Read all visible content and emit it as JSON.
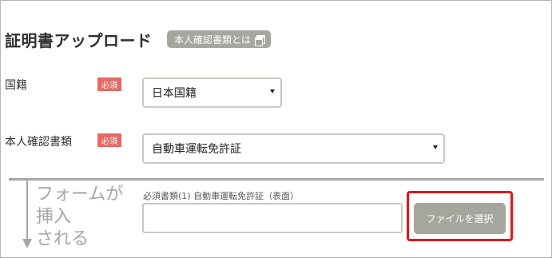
{
  "page": {
    "title": "証明書アップロード",
    "help_badge_label": "本人確認書類とは"
  },
  "form": {
    "nationality": {
      "label": "国籍",
      "required_label": "必須",
      "selected_value": "日本国籍"
    },
    "id_document": {
      "label": "本人確認書類",
      "required_label": "必須",
      "selected_value": "自動車運転免許証"
    }
  },
  "annotation": {
    "inserted_note": "フォームが\n挿入\nされる",
    "highlight_color": "#e0161c"
  },
  "upload": {
    "caption": "必須書類(1) 自動車運転免許証（表面）",
    "file_name_value": "",
    "select_button_label": "ファイルを選択"
  },
  "colors": {
    "required_badge": "#e56a62",
    "gray_button": "#a6a59e",
    "annotation_gray": "#a7a7a7"
  },
  "icons": {
    "help_badge_icon": "window-icon",
    "select_arrow": "caret-down-icon",
    "insert_arrow": "arrow-down-icon"
  }
}
